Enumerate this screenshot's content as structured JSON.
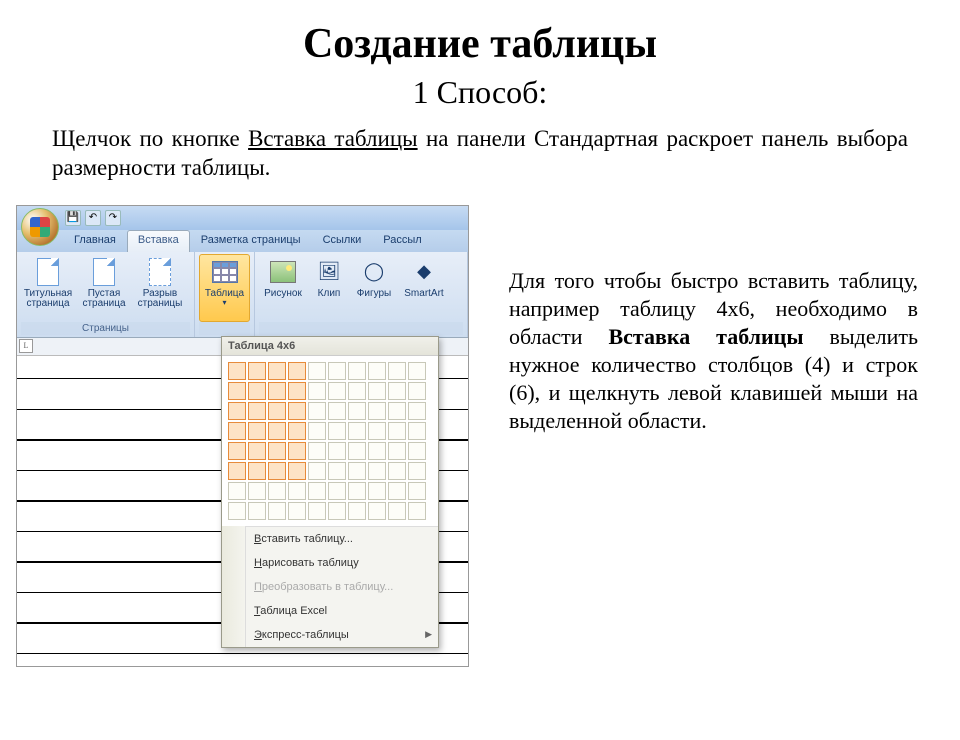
{
  "title": "Создание таблицы",
  "subtitle": "1 Способ:",
  "intro_pre": "Щелчок по кнопке ",
  "intro_u": "Вставка таблицы",
  "intro_post": " на панели Стандартная раскроет панель выбора размерности таблицы.",
  "desc_pre": "Для того чтобы быстро вставить таблицу, например таблицу 4х6, необходимо в области ",
  "desc_bold": "Вставка таблицы",
  "desc_post": " выделить нужное количество столбцов (4) и строк (6), и щелкнуть левой клавишей мыши на выделенной области.",
  "ribbon": {
    "tabs": [
      "Главная",
      "Вставка",
      "Разметка страницы",
      "Ссылки",
      "Рассыл"
    ],
    "active_tab": 1,
    "group_pages": "Страницы",
    "btn_cover": "Титульная\nстраница",
    "btn_blank": "Пустая\nстраница",
    "btn_break": "Разрыв\nстраницы",
    "btn_table": "Таблица",
    "btn_pic": "Рисунок",
    "btn_clip": "Клип",
    "btn_shapes": "Фигуры",
    "btn_smartart": "SmartArt"
  },
  "dropdown": {
    "header": "Таблица 4x6",
    "cols": 10,
    "rows": 8,
    "sel_cols": 4,
    "sel_rows": 6,
    "items": [
      {
        "icon": "table-insert-icon",
        "label": "Вставить таблицу...",
        "enabled": true,
        "sub": false
      },
      {
        "icon": "draw-table-icon",
        "label": "Нарисовать таблицу",
        "enabled": true,
        "sub": false
      },
      {
        "icon": "convert-table-icon",
        "label": "Преобразовать в таблицу...",
        "enabled": false,
        "sub": false
      },
      {
        "icon": "excel-table-icon",
        "label": "Таблица Excel",
        "enabled": true,
        "sub": false
      },
      {
        "icon": "quick-tables-icon",
        "label": "Экспресс-таблицы",
        "enabled": true,
        "sub": true
      }
    ]
  }
}
